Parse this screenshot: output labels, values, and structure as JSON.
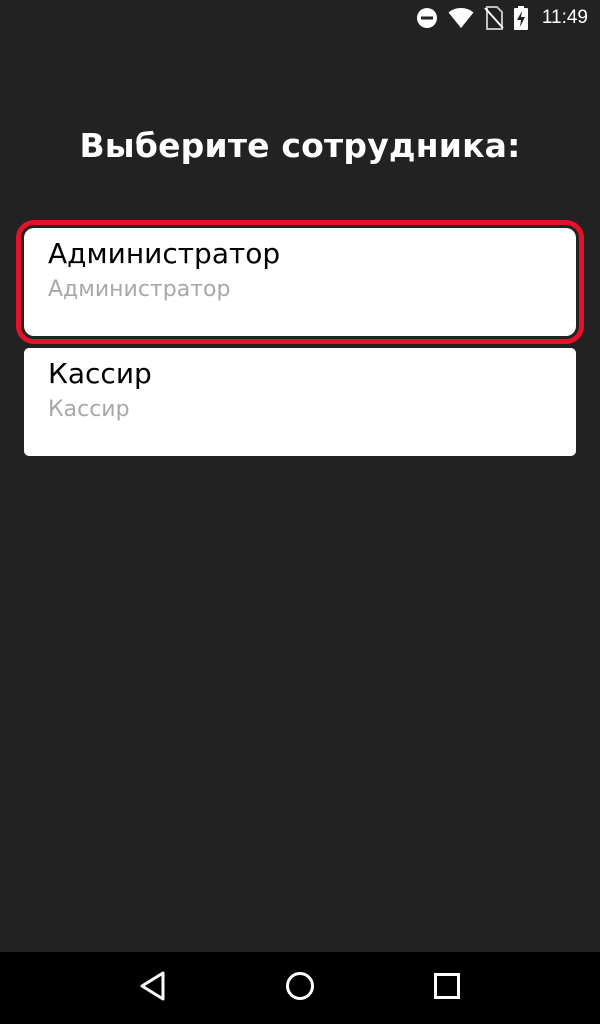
{
  "status_bar": {
    "time": "11:49",
    "icons": [
      "do-not-disturb-icon",
      "wifi-icon",
      "no-sim-icon",
      "battery-charging-icon"
    ]
  },
  "screen": {
    "title": "Выберите сотрудника:"
  },
  "employees": [
    {
      "name": "Администратор",
      "role": "Администратор",
      "selected": true
    },
    {
      "name": "Кассир",
      "role": "Кассир",
      "selected": false
    }
  ],
  "nav_bar": {
    "buttons": [
      "back-icon",
      "home-icon",
      "recents-icon"
    ]
  },
  "colors": {
    "background": "#222222",
    "card": "#ffffff",
    "highlight": "#e3122a",
    "secondary_text": "#a8a8a8",
    "nav_bar": "#000000"
  }
}
